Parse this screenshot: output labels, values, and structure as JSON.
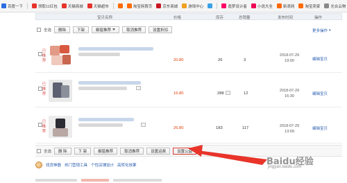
{
  "bookmarks": [
    {
      "label": "百度一下",
      "color": "#2b6de3"
    },
    {
      "label": "领取11红包",
      "color": "#e5332d"
    },
    {
      "label": "天猫商城",
      "color": "#e5332d"
    },
    {
      "label": "天猫超市",
      "color": "#e5332d"
    },
    {
      "label": "",
      "color": "#ff6a00"
    },
    {
      "label": "淘宝网首页",
      "color": "#ff6a00"
    },
    {
      "label": "京东商城",
      "color": "#c81623"
    },
    {
      "label": "游戏中心",
      "color": "#f0a020"
    },
    {
      "label": "",
      "color": "#3aa0e8"
    },
    {
      "label": "造梦设计者",
      "color": "#f06"
    },
    {
      "label": "小说大全",
      "color": "#e05"
    },
    {
      "label": "新浪网",
      "color": "#f60"
    },
    {
      "label": "淘宝卖家",
      "color": "#ff6a00"
    },
    {
      "label": "光合云物",
      "color": "#888"
    }
  ],
  "table_header": {
    "name": "宝贝名称",
    "price": "价格",
    "stock": "库存",
    "sales": "总销量",
    "time": "发布时间",
    "ops": "操作"
  },
  "toolbar_top": {
    "select_all": "全选",
    "delete": "删除",
    "delist": "下架",
    "recommend": "橱窗推荐",
    "cancel_recommend": "取消推荐",
    "set_discount": "设置折扣"
  },
  "more_ops": "更多操作",
  "rows": [
    {
      "status": "已推荐",
      "price": "20.80",
      "stock": "26",
      "sales": "3",
      "date": "2018-07-29",
      "time": "19:00",
      "edit": "编辑宝贝"
    },
    {
      "status": "已推荐",
      "price": "16.80",
      "stock": "288",
      "sales": "12",
      "date": "2018-07-29",
      "time": "16:30",
      "edit": "编辑宝贝"
    },
    {
      "status": "已推荐",
      "price": "26.80",
      "stock": "183",
      "sales": "117",
      "date": "2018-07-29",
      "time": "13:09",
      "edit": "编辑宝贝"
    }
  ],
  "toolbar_bottom": {
    "select_all": "全选",
    "delete": "删 除",
    "delist": "下 架",
    "recommend": "橱窗推荐",
    "cancel_recommend": "取消推荐",
    "set_discount": "设置运费",
    "set_public": "设置公益"
  },
  "promo": {
    "link1": "找货神器",
    "link2": "热门营销工具",
    "link3": "个性店铺设计",
    "link4": "高转化效果"
  },
  "watermark": {
    "logo": "Baidu经验",
    "site": "jingyan.baidu.com"
  },
  "colors": {
    "price": "#e03c00",
    "link": "#2a5db0",
    "arrow": "#e8342a"
  }
}
